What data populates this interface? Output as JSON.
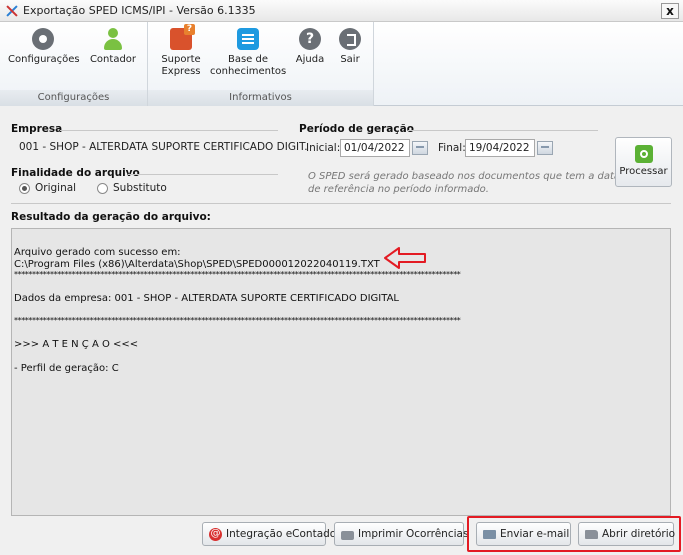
{
  "window": {
    "title": "Exportação SPED ICMS/IPI  -  Versão 6.1335",
    "close_label": "x"
  },
  "ribbon": {
    "groups": [
      {
        "label": "Configurações",
        "buttons": [
          {
            "label": "Configurações",
            "icon": "gear-icon"
          },
          {
            "label": "Contador",
            "icon": "user-icon"
          }
        ]
      },
      {
        "label": "Informativos",
        "buttons": [
          {
            "label_line1": "Suporte",
            "label_line2": "Express",
            "icon": "chat-question-icon"
          },
          {
            "label_line1": "Base de",
            "label_line2": "conhecimentos",
            "icon": "list-icon"
          },
          {
            "label": "Ajuda",
            "icon": "help-icon"
          },
          {
            "label": "Sair",
            "icon": "exit-icon"
          }
        ]
      }
    ]
  },
  "empresa": {
    "label": "Empresa",
    "value": "001 - SHOP - ALTERDATA SUPORTE CERTIFICADO DIGIT."
  },
  "finalidade": {
    "label": "Finalidade do arquivo",
    "options": [
      {
        "label": "Original",
        "selected": true
      },
      {
        "label": "Substituto",
        "selected": false
      }
    ]
  },
  "periodo": {
    "label": "Período de geração",
    "inicial_label": "Inicial:",
    "inicial_value": "01/04/2022",
    "final_label": "Final:",
    "final_value": "19/04/2022",
    "note_line1": "O SPED será gerado baseado nos documentos que tem a data",
    "note_line2": "de referência no período informado."
  },
  "processar_label": "Processar",
  "resultado": {
    "label": "Resultado da geração do arquivo:",
    "lines": [
      "",
      "Arquivo gerado com sucesso em:",
      "C:\\Program Files (x86)\\Alterdata\\Shop\\SPED\\SPED000012022040119.TXT",
      "****************************************************************************************************************************",
      "",
      "Dados da empresa: 001 - SHOP - ALTERDATA SUPORTE CERTIFICADO DIGITAL",
      "",
      "****************************************************************************************************************************",
      "",
      ">>> A T E N Ç Ã O <<<",
      "",
      "- Perfil de geração: C"
    ]
  },
  "footer": {
    "integracao_label": "Integração eContador",
    "imprimir_label": "Imprimir Ocorrências",
    "enviar_label": "Enviar e-mail",
    "abrir_label": "Abrir diretório"
  },
  "colors": {
    "highlight_red": "#e31b23",
    "accent_green": "#7ac142",
    "accent_blue": "#1e9ae0"
  }
}
